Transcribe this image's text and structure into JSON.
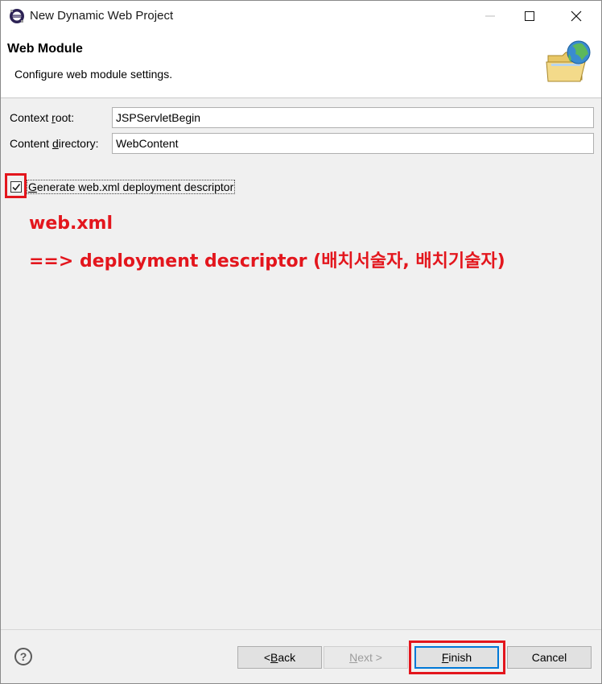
{
  "window": {
    "title": "New Dynamic Web Project",
    "icon": "eclipse-icon"
  },
  "banner": {
    "title": "Web Module",
    "description": "Configure web module settings.",
    "icon": "web-folder-globe-icon"
  },
  "form": {
    "context_root": {
      "label_pre": "Context ",
      "label_mnemonic": "r",
      "label_post": "oot:",
      "value": "JSPServletBegin"
    },
    "content_directory": {
      "label_pre": "Content ",
      "label_mnemonic": "d",
      "label_post": "irectory:",
      "value": "WebContent"
    },
    "generate_descriptor": {
      "label_mnemonic": "G",
      "label_post": "enerate web.xml deployment descriptor",
      "checked": true
    }
  },
  "annotation": {
    "line1": "web.xml",
    "line2": "==> deployment descriptor (배치서술자, 배치기술자)",
    "color": "#e3161d"
  },
  "buttons": {
    "back": {
      "pre": "< ",
      "mnemonic": "B",
      "post": "ack"
    },
    "next": {
      "mnemonic": "N",
      "post": "ext >"
    },
    "finish": {
      "mnemonic": "F",
      "post": "inish"
    },
    "cancel": "Cancel",
    "help": "?"
  }
}
